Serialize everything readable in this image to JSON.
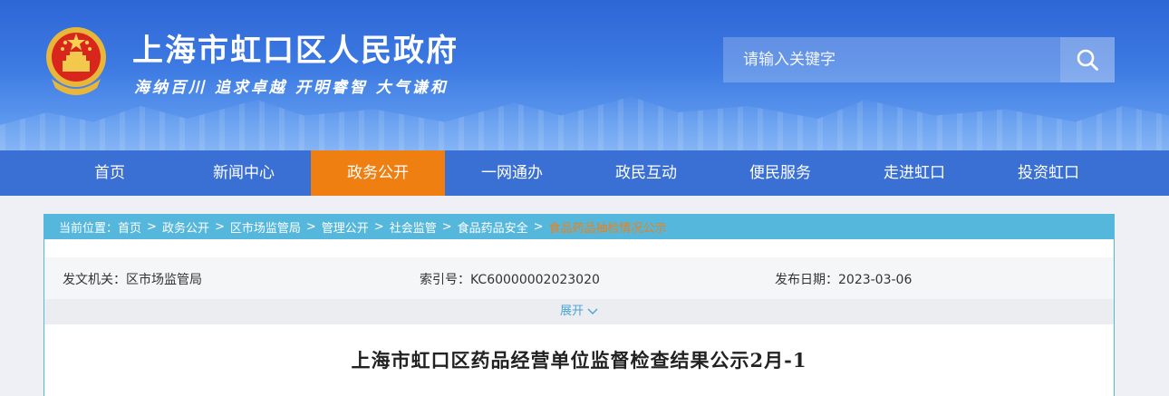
{
  "header": {
    "site_title": "上海市虹口区人民政府",
    "slogan": "海纳百川  追求卓越  开明睿智  大气谦和",
    "search": {
      "placeholder": "请输入关键字"
    }
  },
  "nav": {
    "items": [
      {
        "label": "首页"
      },
      {
        "label": "新闻中心"
      },
      {
        "label": "政务公开"
      },
      {
        "label": "一网通办"
      },
      {
        "label": "政民互动"
      },
      {
        "label": "便民服务"
      },
      {
        "label": "走进虹口"
      },
      {
        "label": "投资虹口"
      }
    ],
    "active_index": 2
  },
  "breadcrumb": {
    "prefix": "当前位置：",
    "items": [
      {
        "label": "首页"
      },
      {
        "label": "政务公开"
      },
      {
        "label": "区市场监管局"
      },
      {
        "label": "管理公开"
      },
      {
        "label": "社会监管"
      },
      {
        "label": "食品药品安全"
      },
      {
        "label": "食品药品抽检情况公示"
      }
    ]
  },
  "meta": {
    "issuer_label": "发文机关：",
    "issuer": "区市场监管局",
    "index_label": "索引号：",
    "index": "KC60000002023020",
    "date_label": "发布日期：",
    "date": "2023-03-06"
  },
  "expand_label": "展开",
  "article": {
    "title": "上海市虹口区药品经营单位监督检查结果公示2月-1"
  },
  "colors": {
    "header_blue": "#3d7ae2",
    "nav_blue": "#3a6fd3",
    "active_orange": "#f07f12",
    "breadcrumb_bar": "#56b7dd"
  }
}
